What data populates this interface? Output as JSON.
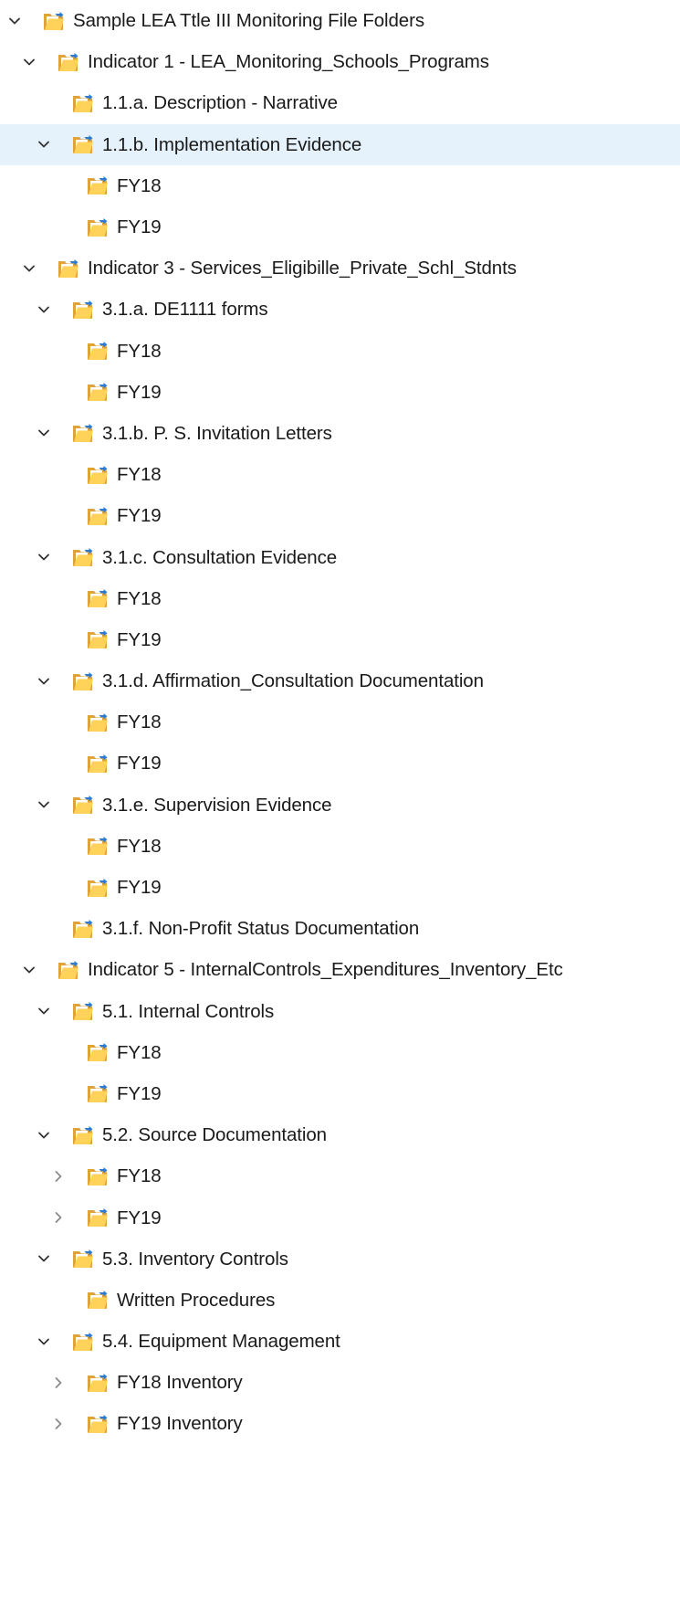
{
  "tree": {
    "items": [
      {
        "label": "Sample LEA Ttle III Monitoring File Folders",
        "level": 0,
        "expander": "expanded"
      },
      {
        "label": "Indicator 1 - LEA_Monitoring_Schools_Programs",
        "level": 1,
        "expander": "expanded"
      },
      {
        "label": "1.1.a. Description - Narrative",
        "level": 2,
        "expander": "none"
      },
      {
        "label": "1.1.b. Implementation Evidence",
        "level": 2,
        "expander": "expanded",
        "selected": true
      },
      {
        "label": "FY18",
        "level": 3,
        "expander": "none"
      },
      {
        "label": "FY19",
        "level": 3,
        "expander": "none"
      },
      {
        "label": "Indicator 3 - Services_Eligibille_Private_Schl_Stdnts",
        "level": 1,
        "expander": "expanded"
      },
      {
        "label": "3.1.a. DE1111 forms",
        "level": 2,
        "expander": "expanded"
      },
      {
        "label": "FY18",
        "level": 3,
        "expander": "none"
      },
      {
        "label": "FY19",
        "level": 3,
        "expander": "none"
      },
      {
        "label": "3.1.b. P. S. Invitation Letters",
        "level": 2,
        "expander": "expanded"
      },
      {
        "label": "FY18",
        "level": 3,
        "expander": "none"
      },
      {
        "label": "FY19",
        "level": 3,
        "expander": "none"
      },
      {
        "label": "3.1.c. Consultation Evidence",
        "level": 2,
        "expander": "expanded"
      },
      {
        "label": "FY18",
        "level": 3,
        "expander": "none"
      },
      {
        "label": "FY19",
        "level": 3,
        "expander": "none"
      },
      {
        "label": "3.1.d. Affirmation_Consultation Documentation",
        "level": 2,
        "expander": "expanded"
      },
      {
        "label": "FY18",
        "level": 3,
        "expander": "none"
      },
      {
        "label": "FY19",
        "level": 3,
        "expander": "none"
      },
      {
        "label": "3.1.e. Supervision Evidence",
        "level": 2,
        "expander": "expanded"
      },
      {
        "label": "FY18",
        "level": 3,
        "expander": "none"
      },
      {
        "label": "FY19",
        "level": 3,
        "expander": "none"
      },
      {
        "label": "3.1.f. Non-Profit Status Documentation",
        "level": 2,
        "expander": "none"
      },
      {
        "label": "Indicator 5 - InternalControls_Expenditures_Inventory_Etc",
        "level": 1,
        "expander": "expanded"
      },
      {
        "label": "5.1. Internal Controls",
        "level": 2,
        "expander": "expanded"
      },
      {
        "label": "FY18",
        "level": 3,
        "expander": "none"
      },
      {
        "label": "FY19",
        "level": 3,
        "expander": "none"
      },
      {
        "label": "5.2. Source Documentation",
        "level": 2,
        "expander": "expanded"
      },
      {
        "label": "FY18",
        "level": 3,
        "expander": "collapsed"
      },
      {
        "label": "FY19",
        "level": 3,
        "expander": "collapsed"
      },
      {
        "label": "5.3. Inventory Controls",
        "level": 2,
        "expander": "expanded"
      },
      {
        "label": "Written Procedures",
        "level": 3,
        "expander": "none"
      },
      {
        "label": "5.4. Equipment Management",
        "level": 2,
        "expander": "expanded"
      },
      {
        "label": "FY18 Inventory",
        "level": 3,
        "expander": "collapsed"
      },
      {
        "label": "FY19 Inventory",
        "level": 3,
        "expander": "collapsed"
      }
    ]
  },
  "icons": {
    "folder": "shared-folder-icon",
    "expanded": "chevron-down-icon",
    "collapsed": "chevron-right-icon"
  },
  "colors": {
    "selection": "#e5f1fb",
    "folder_back": "#e0a33a",
    "folder_front": "#ffd25a",
    "folder_paper": "#ffffff",
    "share_arrow": "#2b7bd6",
    "chevron": "#333333"
  }
}
